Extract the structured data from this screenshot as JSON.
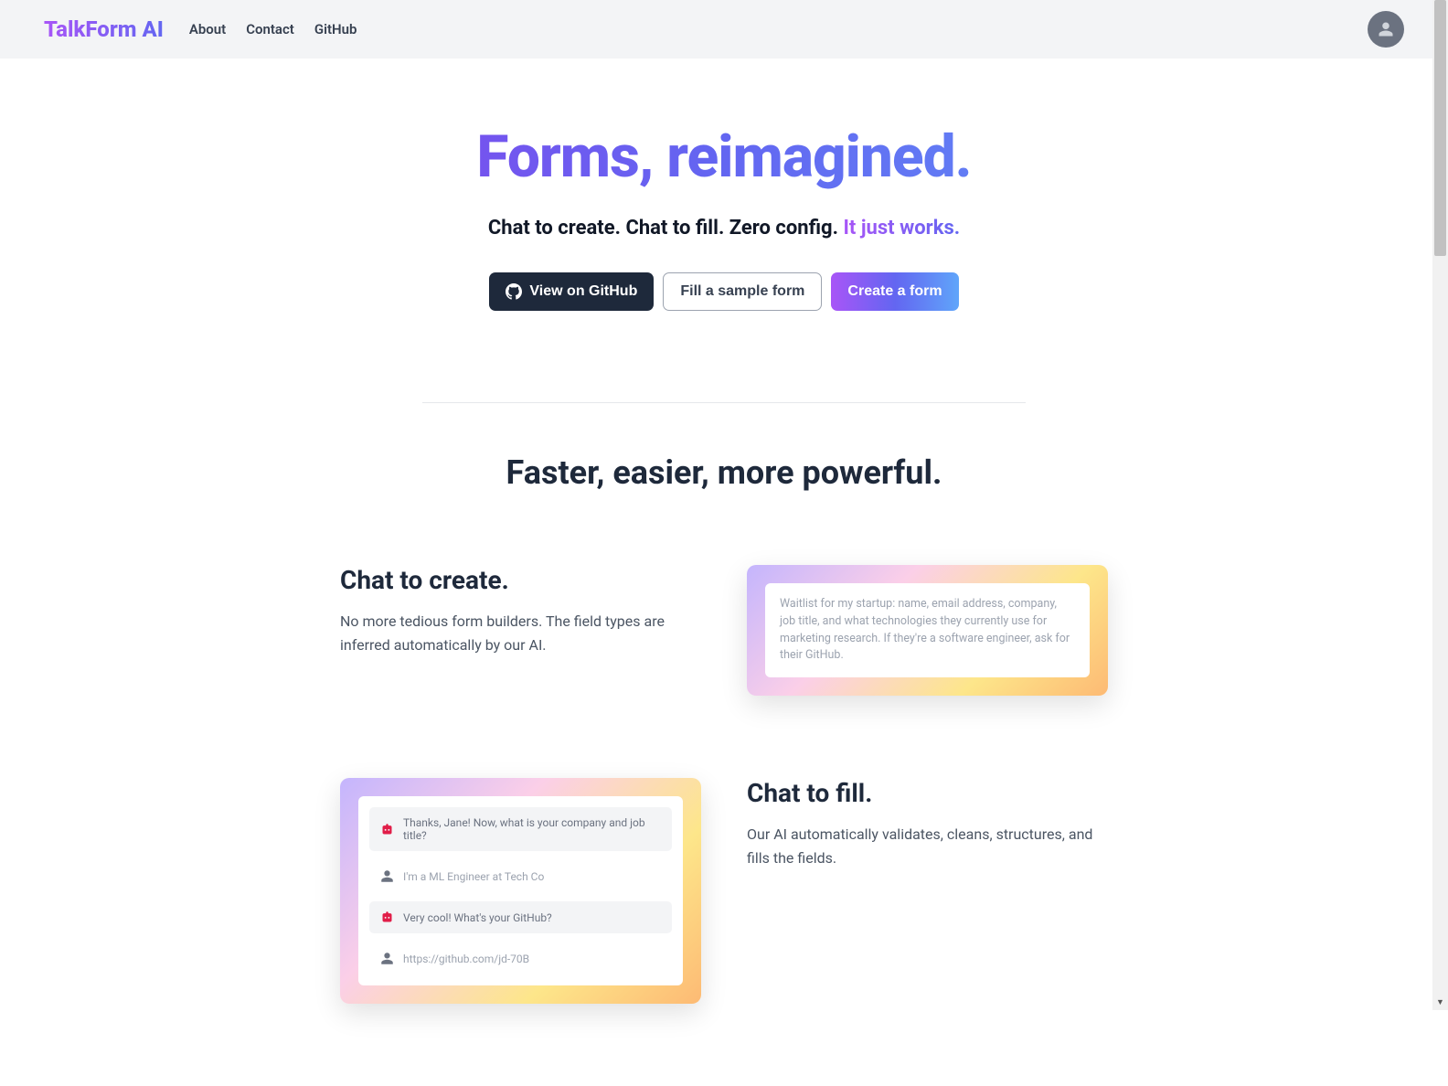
{
  "header": {
    "logo": "TalkForm AI",
    "nav": [
      {
        "label": "About"
      },
      {
        "label": "Contact"
      },
      {
        "label": "GitHub"
      }
    ]
  },
  "hero": {
    "title": "Forms, reimagined.",
    "sub_plain": "Chat to create. Chat to fill. Zero config. ",
    "sub_highlight": "It just works.",
    "buttons": {
      "github": "View on GitHub",
      "sample": "Fill a sample form",
      "create": "Create a form"
    }
  },
  "section_title": "Faster, easier, more powerful.",
  "feature1": {
    "title": "Chat to create.",
    "desc": "No more tedious form builders. The field types are inferred automatically by our AI.",
    "card_text": "Waitlist for my startup: name, email address, company, job title, and what technologies they currently use for marketing research. If they're a software engineer, ask for their GitHub."
  },
  "feature2": {
    "title": "Chat to fill.",
    "desc": "Our AI automatically validates, cleans, structures, and fills the fields.",
    "chat": [
      {
        "role": "bot",
        "text": "Thanks, Jane! Now, what is your company and job title?"
      },
      {
        "role": "user",
        "text": "I'm a ML Engineer at Tech Co"
      },
      {
        "role": "bot",
        "text": "Very cool! What's your GitHub?"
      },
      {
        "role": "user",
        "text": "https://github.com/jd-70B"
      }
    ]
  }
}
